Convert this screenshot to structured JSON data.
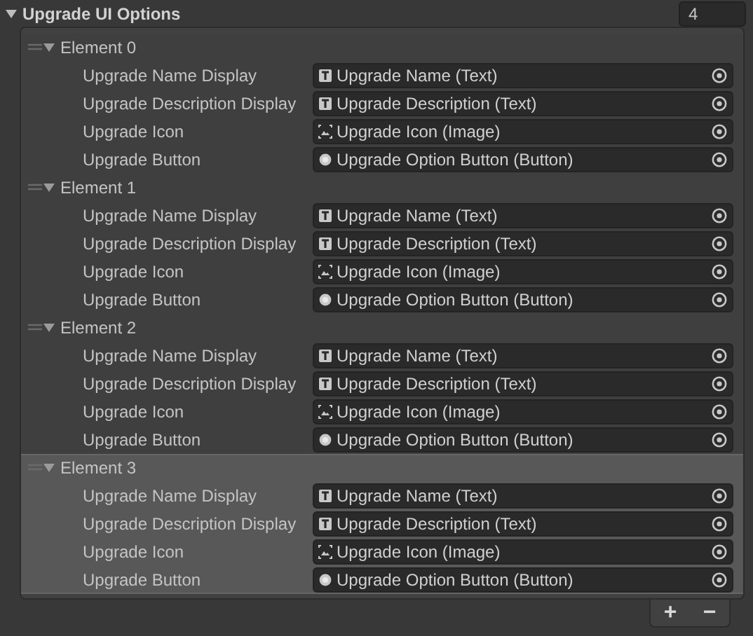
{
  "property": {
    "label": "Upgrade UI Options",
    "expanded": true,
    "size": "4"
  },
  "elements": [
    {
      "title": "Element 0",
      "expanded": true,
      "selected": false,
      "fields": [
        {
          "label": "Upgrade Name Display",
          "value": "Upgrade Name (Text)",
          "kind": "text"
        },
        {
          "label": "Upgrade Description Display",
          "value": "Upgrade Description (Text)",
          "kind": "text"
        },
        {
          "label": "Upgrade Icon",
          "value": "Upgrade Icon (Image)",
          "kind": "image"
        },
        {
          "label": "Upgrade Button",
          "value": "Upgrade Option Button (Button)",
          "kind": "button"
        }
      ]
    },
    {
      "title": "Element 1",
      "expanded": true,
      "selected": false,
      "fields": [
        {
          "label": "Upgrade Name Display",
          "value": "Upgrade Name (Text)",
          "kind": "text"
        },
        {
          "label": "Upgrade Description Display",
          "value": "Upgrade Description (Text)",
          "kind": "text"
        },
        {
          "label": "Upgrade Icon",
          "value": "Upgrade Icon (Image)",
          "kind": "image"
        },
        {
          "label": "Upgrade Button",
          "value": "Upgrade Option Button (Button)",
          "kind": "button"
        }
      ]
    },
    {
      "title": "Element 2",
      "expanded": true,
      "selected": false,
      "fields": [
        {
          "label": "Upgrade Name Display",
          "value": "Upgrade Name (Text)",
          "kind": "text"
        },
        {
          "label": "Upgrade Description Display",
          "value": "Upgrade Description (Text)",
          "kind": "text"
        },
        {
          "label": "Upgrade Icon",
          "value": "Upgrade Icon (Image)",
          "kind": "image"
        },
        {
          "label": "Upgrade Button",
          "value": "Upgrade Option Button (Button)",
          "kind": "button"
        }
      ]
    },
    {
      "title": "Element 3",
      "expanded": true,
      "selected": true,
      "fields": [
        {
          "label": "Upgrade Name Display",
          "value": "Upgrade Name (Text)",
          "kind": "text"
        },
        {
          "label": "Upgrade Description Display",
          "value": "Upgrade Description (Text)",
          "kind": "text"
        },
        {
          "label": "Upgrade Icon",
          "value": "Upgrade Icon (Image)",
          "kind": "image"
        },
        {
          "label": "Upgrade Button",
          "value": "Upgrade Option Button (Button)",
          "kind": "button"
        }
      ]
    }
  ],
  "footer": {
    "add": "+",
    "remove": "−"
  }
}
